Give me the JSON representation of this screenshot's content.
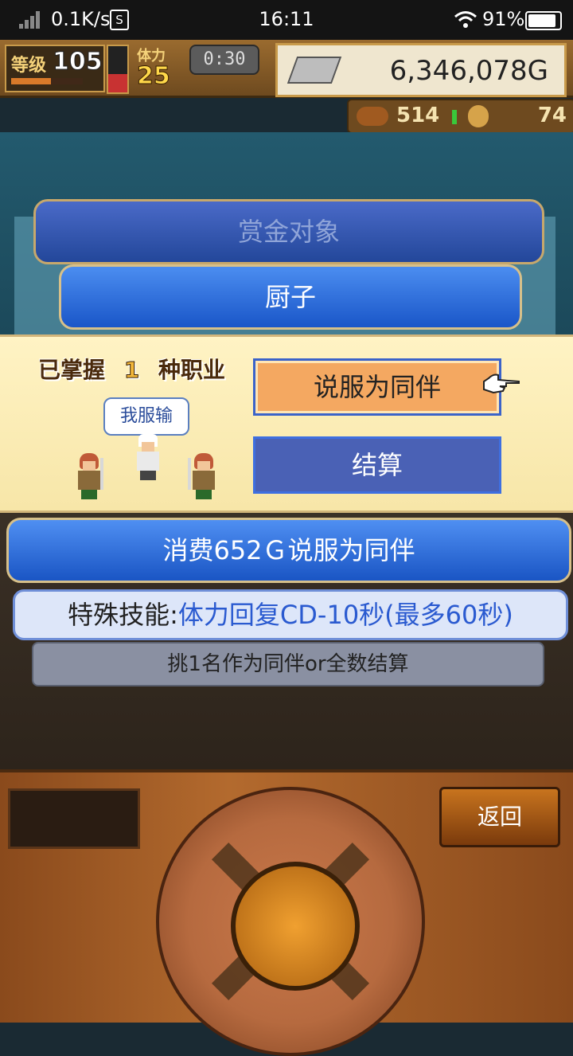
{
  "status_bar": {
    "net_speed": "0.1K/s",
    "s_badge": "S",
    "time": "16:11",
    "battery": "91%"
  },
  "hud": {
    "level_label": "等级",
    "level": "105",
    "stamina_label": "体力",
    "stamina": "25",
    "timer": "0:30",
    "gold": "6,346,078G",
    "resource1": "514",
    "resource2": "74"
  },
  "dialog": {
    "bounty_title": "赏金对象",
    "target_name": "厨子",
    "mastered_prefix": "已掌握",
    "mastered_count": "1",
    "mastered_suffix": "种职业",
    "speech": "我服输",
    "persuade_label": "说服为同伴",
    "settle_label": "结算"
  },
  "info": {
    "cost_text": "消费652Ｇ说服为同伴",
    "skill_prefix": "特殊技能:",
    "skill_value": "体力回复CD-10秒(最多60秒)",
    "hint": "挑1名作为同伴or全数结算"
  },
  "controller": {
    "back_label": "返回"
  },
  "icons": [
    "signal-icon",
    "wifi-icon",
    "battery-icon",
    "gold-bar-icon",
    "meat-icon",
    "coin-icon",
    "pointing-hand-icon"
  ]
}
